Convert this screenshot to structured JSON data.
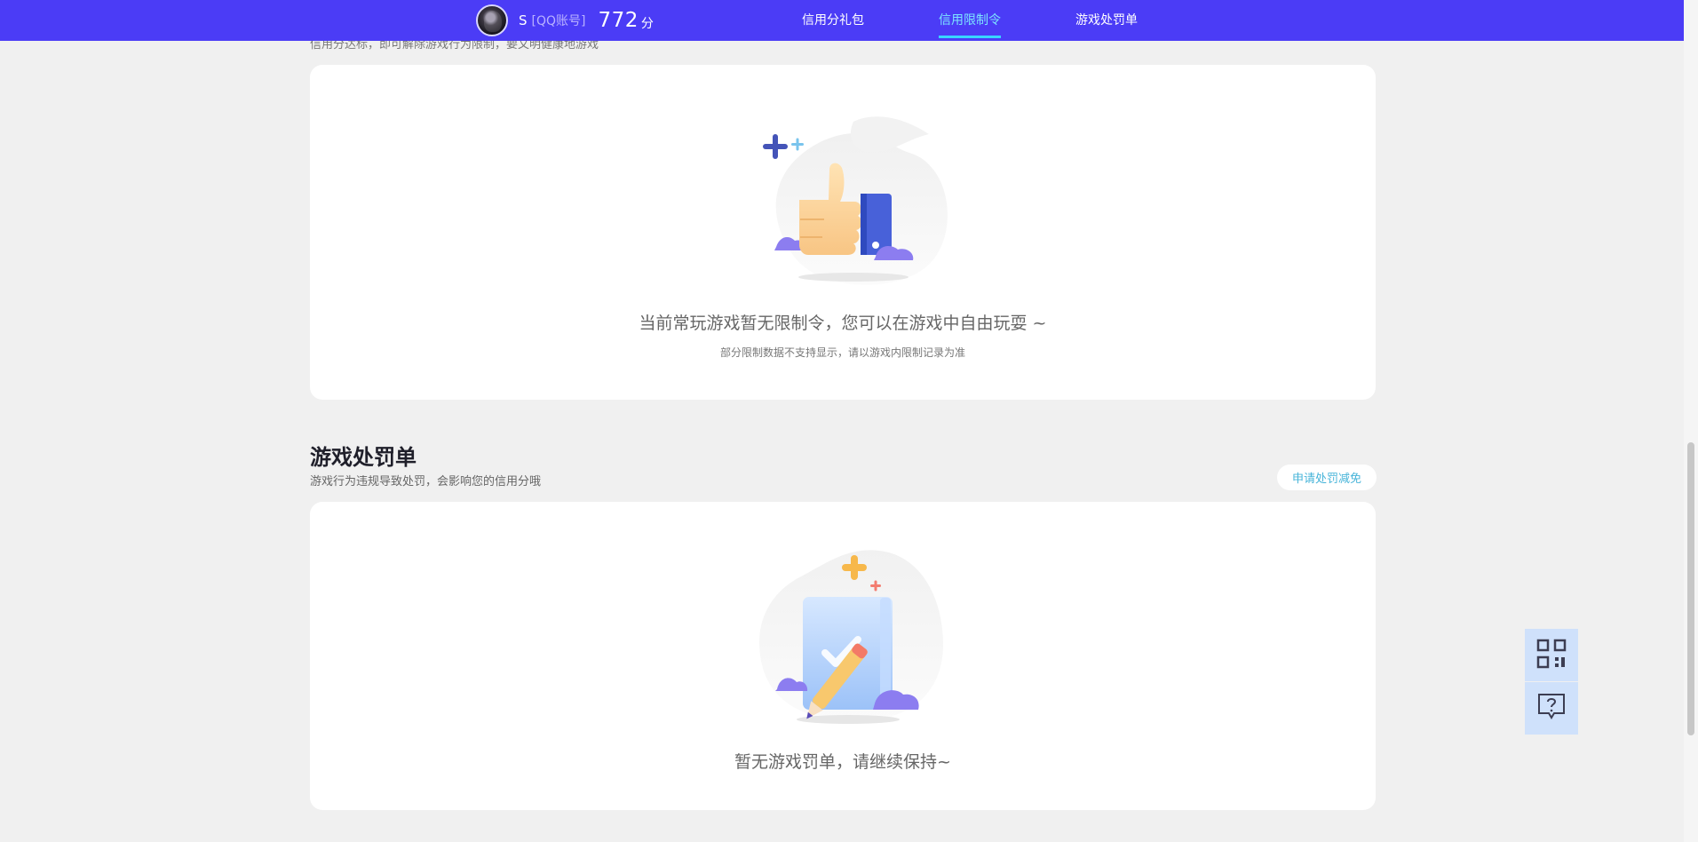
{
  "header": {
    "user_name": "S",
    "account_type": "[QQ账号]",
    "credit_score": "772",
    "score_unit": "分",
    "tabs": [
      {
        "label": "信用分礼包",
        "active": false
      },
      {
        "label": "信用限制令",
        "active": true
      },
      {
        "label": "游戏处罚单",
        "active": false
      }
    ]
  },
  "restriction_section": {
    "description_cut": "信用分达标，即可解除游戏行为限制，要文明健康地游戏",
    "empty_title": "当前常玩游戏暂无限制令，您可以在游戏中自由玩耍 ~",
    "empty_note": "部分限制数据不支持显示，请以游戏内限制记录为准"
  },
  "penalty_section": {
    "title": "游戏处罚单",
    "subtitle": "游戏行为违规导致处罚，会影响您的信用分哦",
    "appeal_button": "申请处罚减免",
    "empty_title": "暂无游戏罚单，请继续保持~"
  },
  "floating_tools": {
    "icons": [
      "qr-code-icon",
      "help-question-icon"
    ]
  },
  "colors": {
    "nav_bg": "#4b3cf6",
    "active_tab": "#7ce4ff",
    "accent_link": "#47b4d9",
    "float_bg": "#cfe1fb"
  }
}
